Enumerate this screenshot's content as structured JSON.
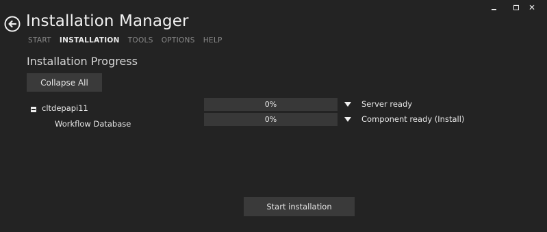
{
  "window": {
    "minimize_icon": "minimize-icon",
    "maximize_icon": "maximize-icon",
    "close_glyph": "✕"
  },
  "header": {
    "back_icon": "back-arrow-icon",
    "title": "Installation Manager"
  },
  "nav": {
    "items": [
      {
        "label": "START",
        "active": false
      },
      {
        "label": "INSTALLATION",
        "active": true
      },
      {
        "label": "TOOLS",
        "active": false
      },
      {
        "label": "OPTIONS",
        "active": false
      },
      {
        "label": "HELP",
        "active": false
      }
    ]
  },
  "main": {
    "section_title": "Installation Progress",
    "collapse_label": "Collapse All",
    "tree": {
      "server": {
        "name": "cltdepapi11",
        "expanded": true,
        "progress_label": "0%",
        "progress_value": 0,
        "status": "Server ready"
      },
      "components": [
        {
          "name": "Workflow Database",
          "progress_label": "0%",
          "progress_value": 0,
          "status": "Component ready (Install)"
        }
      ]
    },
    "start_label": "Start installation"
  },
  "colors": {
    "background": "#232323",
    "button": "#3a3a3a",
    "progress_track": "#383838",
    "progress_fill": "#4a7f3a",
    "text": "#e8e8e8",
    "nav_inactive": "#8a8a8a"
  }
}
